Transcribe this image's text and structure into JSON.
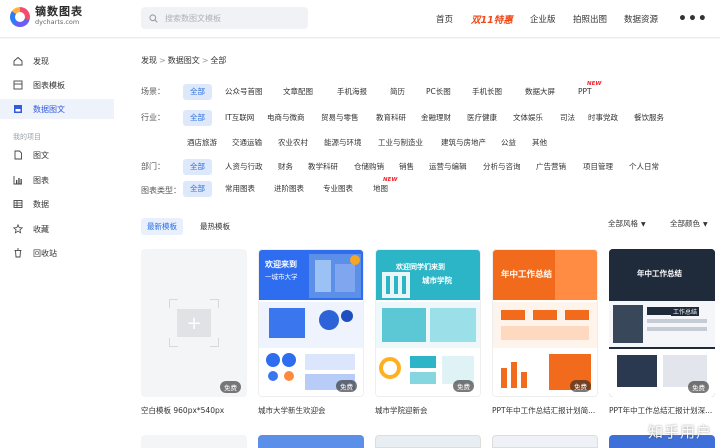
{
  "logo": {
    "name_cn": "镝数图表",
    "domain": "dycharts.com"
  },
  "search": {
    "placeholder": "搜索数图文模板"
  },
  "nav": {
    "home": "首页",
    "promo": "双11特惠",
    "enterprise": "企业版",
    "screenshot": "拍照出图",
    "resource": "数据资源",
    "more": "•••"
  },
  "sidebar": {
    "items": [
      {
        "label": "发现",
        "icon": "home-icon"
      },
      {
        "label": "图表模板",
        "icon": "chart-template-icon"
      },
      {
        "label": "数据图文",
        "icon": "infographic-icon",
        "active": true
      }
    ],
    "section_title": "我的项目",
    "project_items": [
      {
        "label": "图文",
        "icon": "document-icon"
      },
      {
        "label": "图表",
        "icon": "bar-chart-icon"
      },
      {
        "label": "数据",
        "icon": "table-icon"
      },
      {
        "label": "收藏",
        "icon": "star-icon"
      },
      {
        "label": "回收站",
        "icon": "trash-icon"
      }
    ]
  },
  "breadcrumb": [
    "发现",
    ">",
    "数据图文",
    ">",
    "全部"
  ],
  "filters": {
    "scene": {
      "label": "场景：",
      "options": [
        "全部",
        "公众号首图",
        "文章配图",
        "手机海报",
        "简历",
        "PC长图",
        "手机长图",
        "数据大屏",
        "PPT"
      ],
      "new_badge": "NEW"
    },
    "industry": {
      "label": "行业：",
      "options_row1": [
        "全部",
        "IT互联网",
        "电商与微商",
        "贸易与零售",
        "教育科研",
        "金融理财",
        "医疗健康",
        "文体娱乐",
        "司法",
        "时事党政",
        "餐饮服务"
      ],
      "options_row2": [
        "酒店旅游",
        "交通运输",
        "农业农村",
        "能源与环境",
        "工业与制造业",
        "建筑与房地产",
        "公益",
        "其他"
      ]
    },
    "department": {
      "label": "部门：",
      "options": [
        "全部",
        "人资与行政",
        "财务",
        "教学科研",
        "仓储购销",
        "销售",
        "运营与编辑",
        "分析与咨询",
        "广告营销",
        "项目管理",
        "个人日常"
      ]
    },
    "chart_type": {
      "label": "图表类型：",
      "options": [
        "全部",
        "常用图表",
        "进阶图表",
        "专业图表",
        "地图"
      ],
      "new_badge": "NEW"
    }
  },
  "tabs": {
    "latest": "最新模板",
    "hottest": "最热模板"
  },
  "dropdowns": {
    "style": "全部风格",
    "color": "全部颜色",
    "caret": "▼"
  },
  "cards": [
    {
      "label": "空白模板 960px*540px",
      "badge": "免费"
    },
    {
      "label": "城市大学新生欢迎会",
      "badge": "免费",
      "title": "欢迎来到",
      "subtitle": "一城市大学"
    },
    {
      "label": "城市学院迎新会",
      "badge": "免费",
      "title": "欢迎同学们来到",
      "subtitle": "城市学院"
    },
    {
      "label": "PPT年中工作总结汇报计划简...",
      "badge": "免费",
      "title": "年中工作总结"
    },
    {
      "label": "PPT年中工作总结汇报计划深...",
      "badge": "免费",
      "title": "年中工作总结",
      "subtitle": "工作总结"
    }
  ],
  "watermark": "知乎用户",
  "colors": {
    "accent": "#2f6fe0",
    "promo": "#f04a18",
    "active_bg": "#dde8fb",
    "orange": "#f26b1d",
    "dark_card": "#1f2a3a"
  }
}
